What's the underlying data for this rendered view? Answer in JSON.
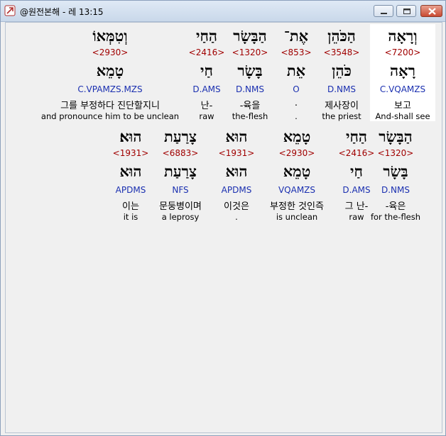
{
  "window": {
    "title": "@원전본해 - 레 13:15"
  },
  "rows": [
    {
      "words": [
        {
          "hebrew": "וְרָאָה",
          "strongs": "<7200>",
          "lemma": "רָאָה",
          "parse": "C.VQAMZS",
          "korean": "보고",
          "english": "And-shall see"
        },
        {
          "hebrew": "הַכֹּהֵן",
          "strongs": "<3548>",
          "lemma": "כֹּהֵן",
          "parse": "D.NMS",
          "korean": "제사장이",
          "english": "the priest"
        },
        {
          "hebrew": "אֶת־",
          "strongs": "<853>",
          "lemma": "אֵת",
          "parse": "O",
          "korean": ".",
          "english": "."
        },
        {
          "hebrew": "הַבָּשָׂר",
          "strongs": "<1320>",
          "lemma": "בָּשָׂר",
          "parse": "D.NMS",
          "korean": "-육을",
          "english": "the-flesh"
        },
        {
          "hebrew": "הַחַי",
          "strongs": "<2416>",
          "lemma": "חַי",
          "parse": "D.AMS",
          "korean": "난-",
          "english": "raw"
        },
        {
          "hebrew": "וְטִמְּאוֹ",
          "strongs": "<2930>",
          "lemma": "טָמֵא",
          "parse": "C.VPAMZS.MZS",
          "korean": "그를 부정하다 진단할지니",
          "english": "and pronounce him to be unclean"
        }
      ]
    },
    {
      "words": [
        {
          "hebrew": "הַבָּשָׂר",
          "strongs": "<1320>",
          "lemma": "בָּשָׂר",
          "parse": "D.NMS",
          "korean": "-육은",
          "english": "for the-flesh"
        },
        {
          "hebrew": "הַחַי",
          "strongs": "<2416>",
          "lemma": "חַי",
          "parse": "D.AMS",
          "korean": "그 난-",
          "english": "raw"
        },
        {
          "hebrew": "טָמֵא",
          "strongs": "<2930>",
          "lemma": "טָמֵא",
          "parse": "VQAMZS",
          "korean": "부정한 것인즉",
          "english": "is unclean"
        },
        {
          "hebrew": "הוּא",
          "strongs": "<1931>",
          "lemma": "הוּא",
          "parse": "APDMS",
          "korean": "이것은",
          "english": "."
        },
        {
          "hebrew": "צָרַעַת",
          "strongs": "<6883>",
          "lemma": "צָרַעַת",
          "parse": "NFS",
          "korean": "문둥병이며",
          "english": "a leprosy"
        },
        {
          "hebrew": "הוּא׃",
          "strongs": "<1931>",
          "lemma": "הוּא",
          "parse": "APDMS",
          "korean": "이는",
          "english": "it is"
        }
      ]
    }
  ],
  "colors": {
    "strongs": "#a00000",
    "parse": "#1a2fb0",
    "highlight": "#ffffff"
  }
}
